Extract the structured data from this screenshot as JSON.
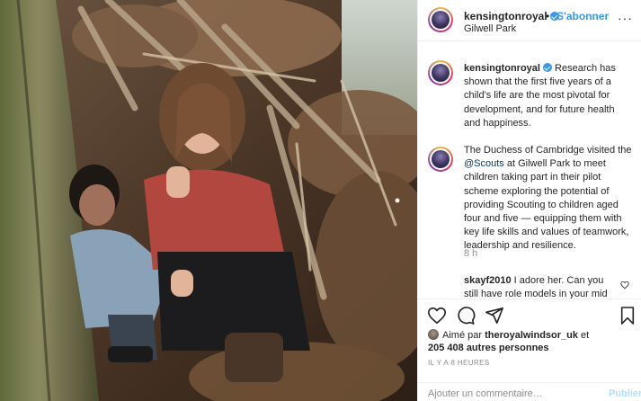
{
  "post": {
    "username": "kensingtonroyal",
    "dot": "•",
    "follow_label": "S'abonner",
    "location": "Gilwell Park",
    "more_label": "···",
    "caption_user": "kensingtonroyal",
    "caption_p1": "Research has shown that the first five years of a child's life are the most pivotal for development, and for future health and happiness.",
    "caption_p2_a": "The Duchess of Cambridge visited the ",
    "caption_p2_mention": "@Scouts",
    "caption_p2_b": " at Gilwell Park to meet children taking part in their pilot scheme exploring the potential of providing Scouting to children aged four and five — equipping them with key life skills and values of teamwork, leadership and resilience.",
    "caption_time": "8 h",
    "comment_user": "skayf2010",
    "comment_text": "I adore her. Can you still have role models in your mid",
    "likes_prefix": "Aimé par ",
    "likes_user": "theroyalwindsor_uk",
    "likes_mid": " et",
    "likes_count": "205 408 autres personnes",
    "posted_ago": "IL Y A 8 HEURES",
    "comment_placeholder": "Ajouter un commentaire…",
    "post_label": "Publier"
  },
  "icons": {
    "like": "heart-icon",
    "comment": "comment-icon",
    "share": "share-icon",
    "save": "bookmark-icon",
    "verified": "verified-badge-icon"
  },
  "colors": {
    "link_blue": "#3897f0",
    "mention": "#00376b",
    "muted": "#8e8e8e",
    "post_disabled": "#b2dffc"
  }
}
